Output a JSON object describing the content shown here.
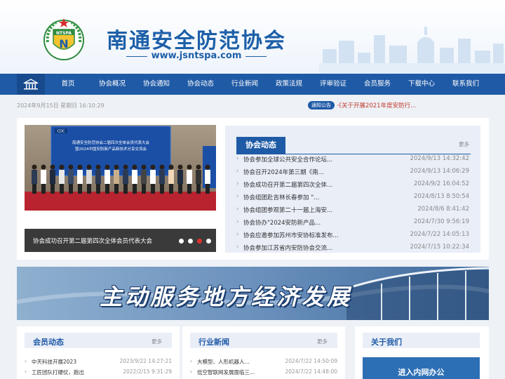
{
  "header": {
    "logo_text": "NTSPA",
    "logo_letter": "N",
    "title": "南通安全防范协会",
    "url": "www.jsntspa.com"
  },
  "nav": {
    "items": [
      "首页",
      "协会概况",
      "协会通知",
      "协会动态",
      "行业新闻",
      "政策法规",
      "评审验证",
      "会员服务",
      "下载中心",
      "联系我们"
    ]
  },
  "info": {
    "date": "2024年9月15日 星期日 16:10:29",
    "notice_badge": "通知公告",
    "notice_text": "·《关于开展2021年度安防行..."
  },
  "slideshow": {
    "screen_title_1": "南通安全防范协会二届四次全体会员代表大会",
    "screen_title_2": "暨2024中国安防新产品新技术分享交流会",
    "screen_logo": "CDC",
    "caption": "协会成功召开第二届第四次全体会员代表大会",
    "dots": 4,
    "active_dot": 2
  },
  "news_panel": {
    "title": "协会动态",
    "more": "更多",
    "items": [
      {
        "title": "协会参加全球公共安全合作论坛...",
        "date": "2024/9/13 14:32:42"
      },
      {
        "title": "协会召开2024年第三期《南...",
        "date": "2024/9/13 14:06:29"
      },
      {
        "title": "协会成功召开第二届第四次全体...",
        "date": "2024/9/2 16:04:52"
      },
      {
        "title": "协会组团赴吉林长春参加 \"...",
        "date": "2024/8/13 8:50:54"
      },
      {
        "title": "协会组团参观第二十一届上海安...",
        "date": "2024/8/6 8:41:42"
      },
      {
        "title": "协会协办\"2024安防新产品...",
        "date": "2024/7/30 9:56:19"
      },
      {
        "title": "协会应邀参加苏州市安协标准发布...",
        "date": "2024/7/22 14:05:13"
      },
      {
        "title": "协会参加江苏省内安防协会交流...",
        "date": "2024/7/15 10:22:34"
      }
    ]
  },
  "banner": {
    "text": "主动服务地方经济发展"
  },
  "member_news": {
    "title": "会员动态",
    "more": "更多",
    "items": [
      {
        "title": "中天科技开展2023",
        "date": "2023/9/22 14:27:21"
      },
      {
        "title": "工匠团队打硬仗，跑出",
        "date": "2022/2/15 9:31:29"
      }
    ]
  },
  "industry_news": {
    "title": "行业新闻",
    "more": "更多",
    "items": [
      {
        "title": "大模型、人形机器人...",
        "date": "2024/7/22 14:50:09"
      },
      {
        "title": "低空智联网发展面临三...",
        "date": "2024/7/22 14:48:00"
      }
    ]
  },
  "about": {
    "title": "关于我们",
    "intranet_button": "进入内网办公"
  },
  "colors": {
    "primary": "#1f5aa6",
    "accent_red": "#e03030",
    "panel_bg": "#e9eef7"
  }
}
